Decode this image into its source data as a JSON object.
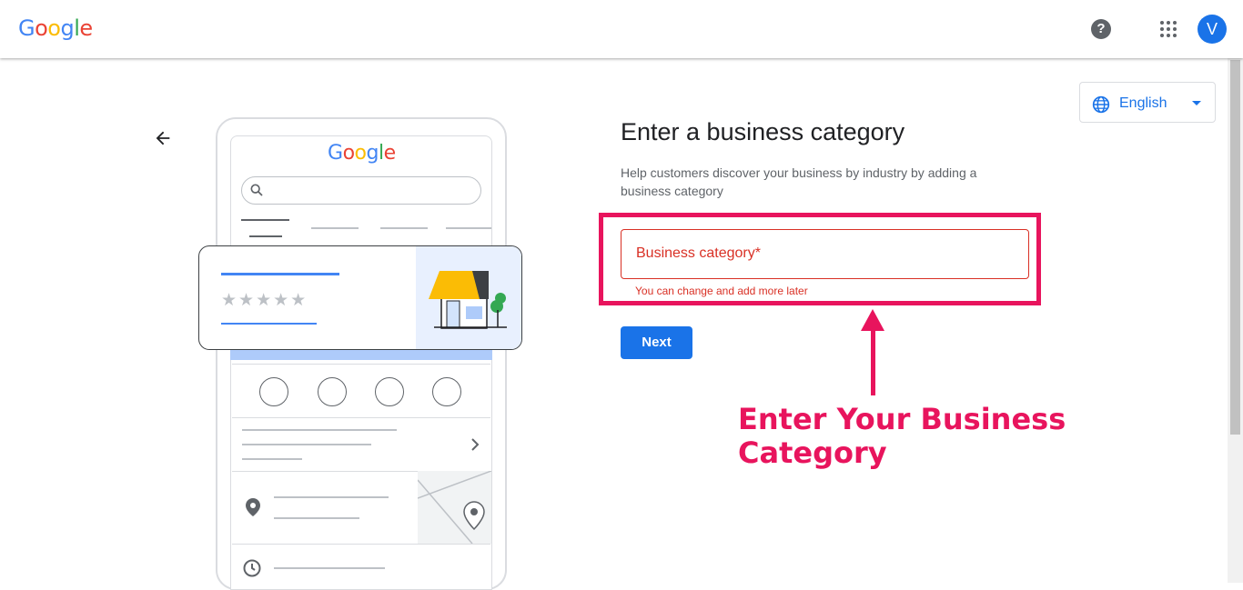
{
  "header": {
    "logo_letters": [
      "G",
      "o",
      "o",
      "g",
      "l",
      "e"
    ],
    "logo_colors": [
      "#4285f4",
      "#ea4335",
      "#fbbc05",
      "#4285f4",
      "#34a853",
      "#ea4335"
    ],
    "help_icon": "help-icon",
    "apps_icon": "apps-grid-icon",
    "avatar_letter": "V"
  },
  "language": {
    "label": "English",
    "icon": "globe-icon"
  },
  "illustration": {
    "logo_letters": [
      "G",
      "o",
      "o",
      "g",
      "l",
      "e"
    ],
    "stars": "★★★★★"
  },
  "form": {
    "title": "Enter a business category",
    "description": "Help customers discover your business by industry by adding a business category",
    "field_label": "Business category*",
    "field_hint": "You can change and add more later",
    "next_label": "Next"
  },
  "annotation": {
    "text": "Enter Your Business Category",
    "color": "#e8145d"
  },
  "colors": {
    "accent": "#1a73e8",
    "error": "#d93025"
  }
}
